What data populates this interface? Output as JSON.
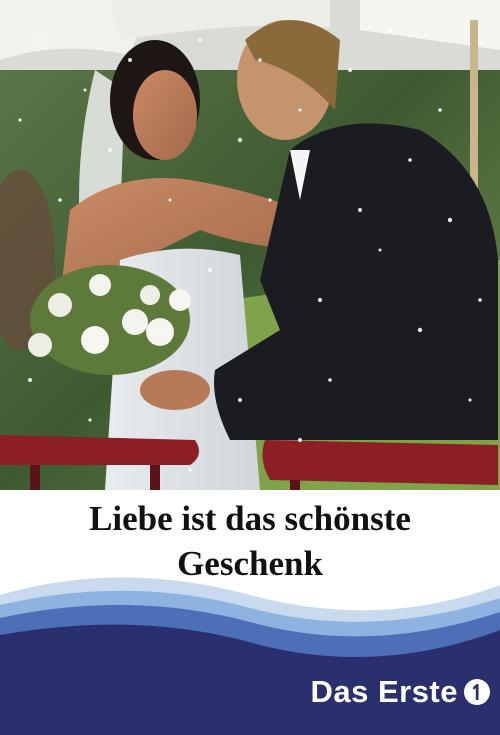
{
  "poster": {
    "title_line1": "Liebe ist das schönste",
    "title_line2": "Geschenk",
    "channel_name": "Das Erste",
    "channel_logo_icon": "ard-1-logo-icon",
    "colors": {
      "navy": "#2a2f6e",
      "wave_light": "#8fb3e0",
      "wave_mid": "#4d6fb8",
      "title_text": "#111111",
      "brand_text": "#ffffff"
    }
  }
}
